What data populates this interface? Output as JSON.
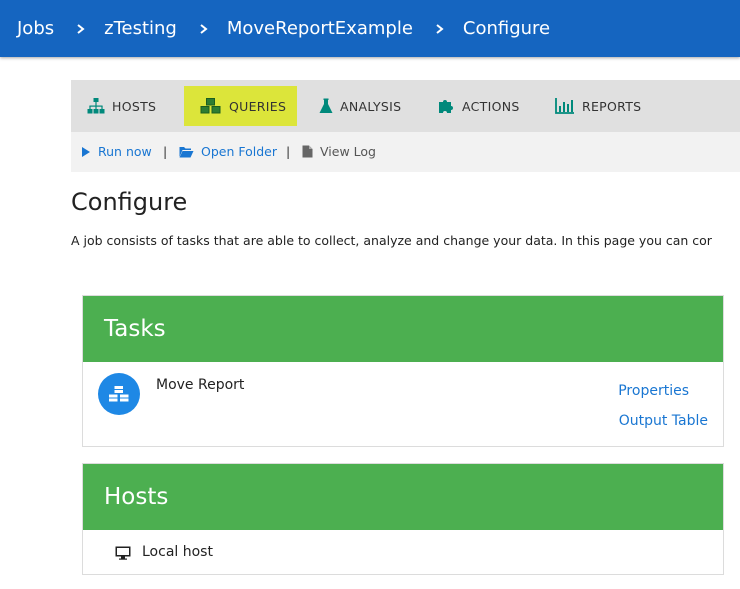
{
  "breadcrumb": {
    "items": [
      "Jobs",
      "zTesting",
      "MoveReportExample",
      "Configure"
    ]
  },
  "toolbar": {
    "tabs": [
      {
        "label": "HOSTS",
        "icon": "sitemap-icon"
      },
      {
        "label": "QUERIES",
        "icon": "cubes-icon",
        "active": true
      },
      {
        "label": "ANALYSIS",
        "icon": "flask-icon"
      },
      {
        "label": "ACTIONS",
        "icon": "puzzle-icon"
      },
      {
        "label": "REPORTS",
        "icon": "bar-chart-icon"
      }
    ],
    "active_color": "#dce53a"
  },
  "actions": {
    "run_now": "Run now",
    "open_folder": "Open Folder",
    "view_log": "View Log",
    "separator": "|"
  },
  "page": {
    "title": "Configure",
    "intro": "A job consists of tasks that are able to collect, analyze and change your data. In this page you can cor"
  },
  "tasks_panel": {
    "title": "Tasks",
    "items": [
      {
        "name": "Move Report",
        "links": [
          "Properties",
          "Output Table"
        ]
      }
    ]
  },
  "hosts_panel": {
    "title": "Hosts",
    "items": [
      {
        "name": "Local host",
        "icon": "desktop-icon"
      }
    ]
  },
  "colors": {
    "topbar": "#1565c0",
    "panel_header": "#4caf50",
    "link": "#1976d2",
    "task_icon_bg": "#1e88e5"
  }
}
